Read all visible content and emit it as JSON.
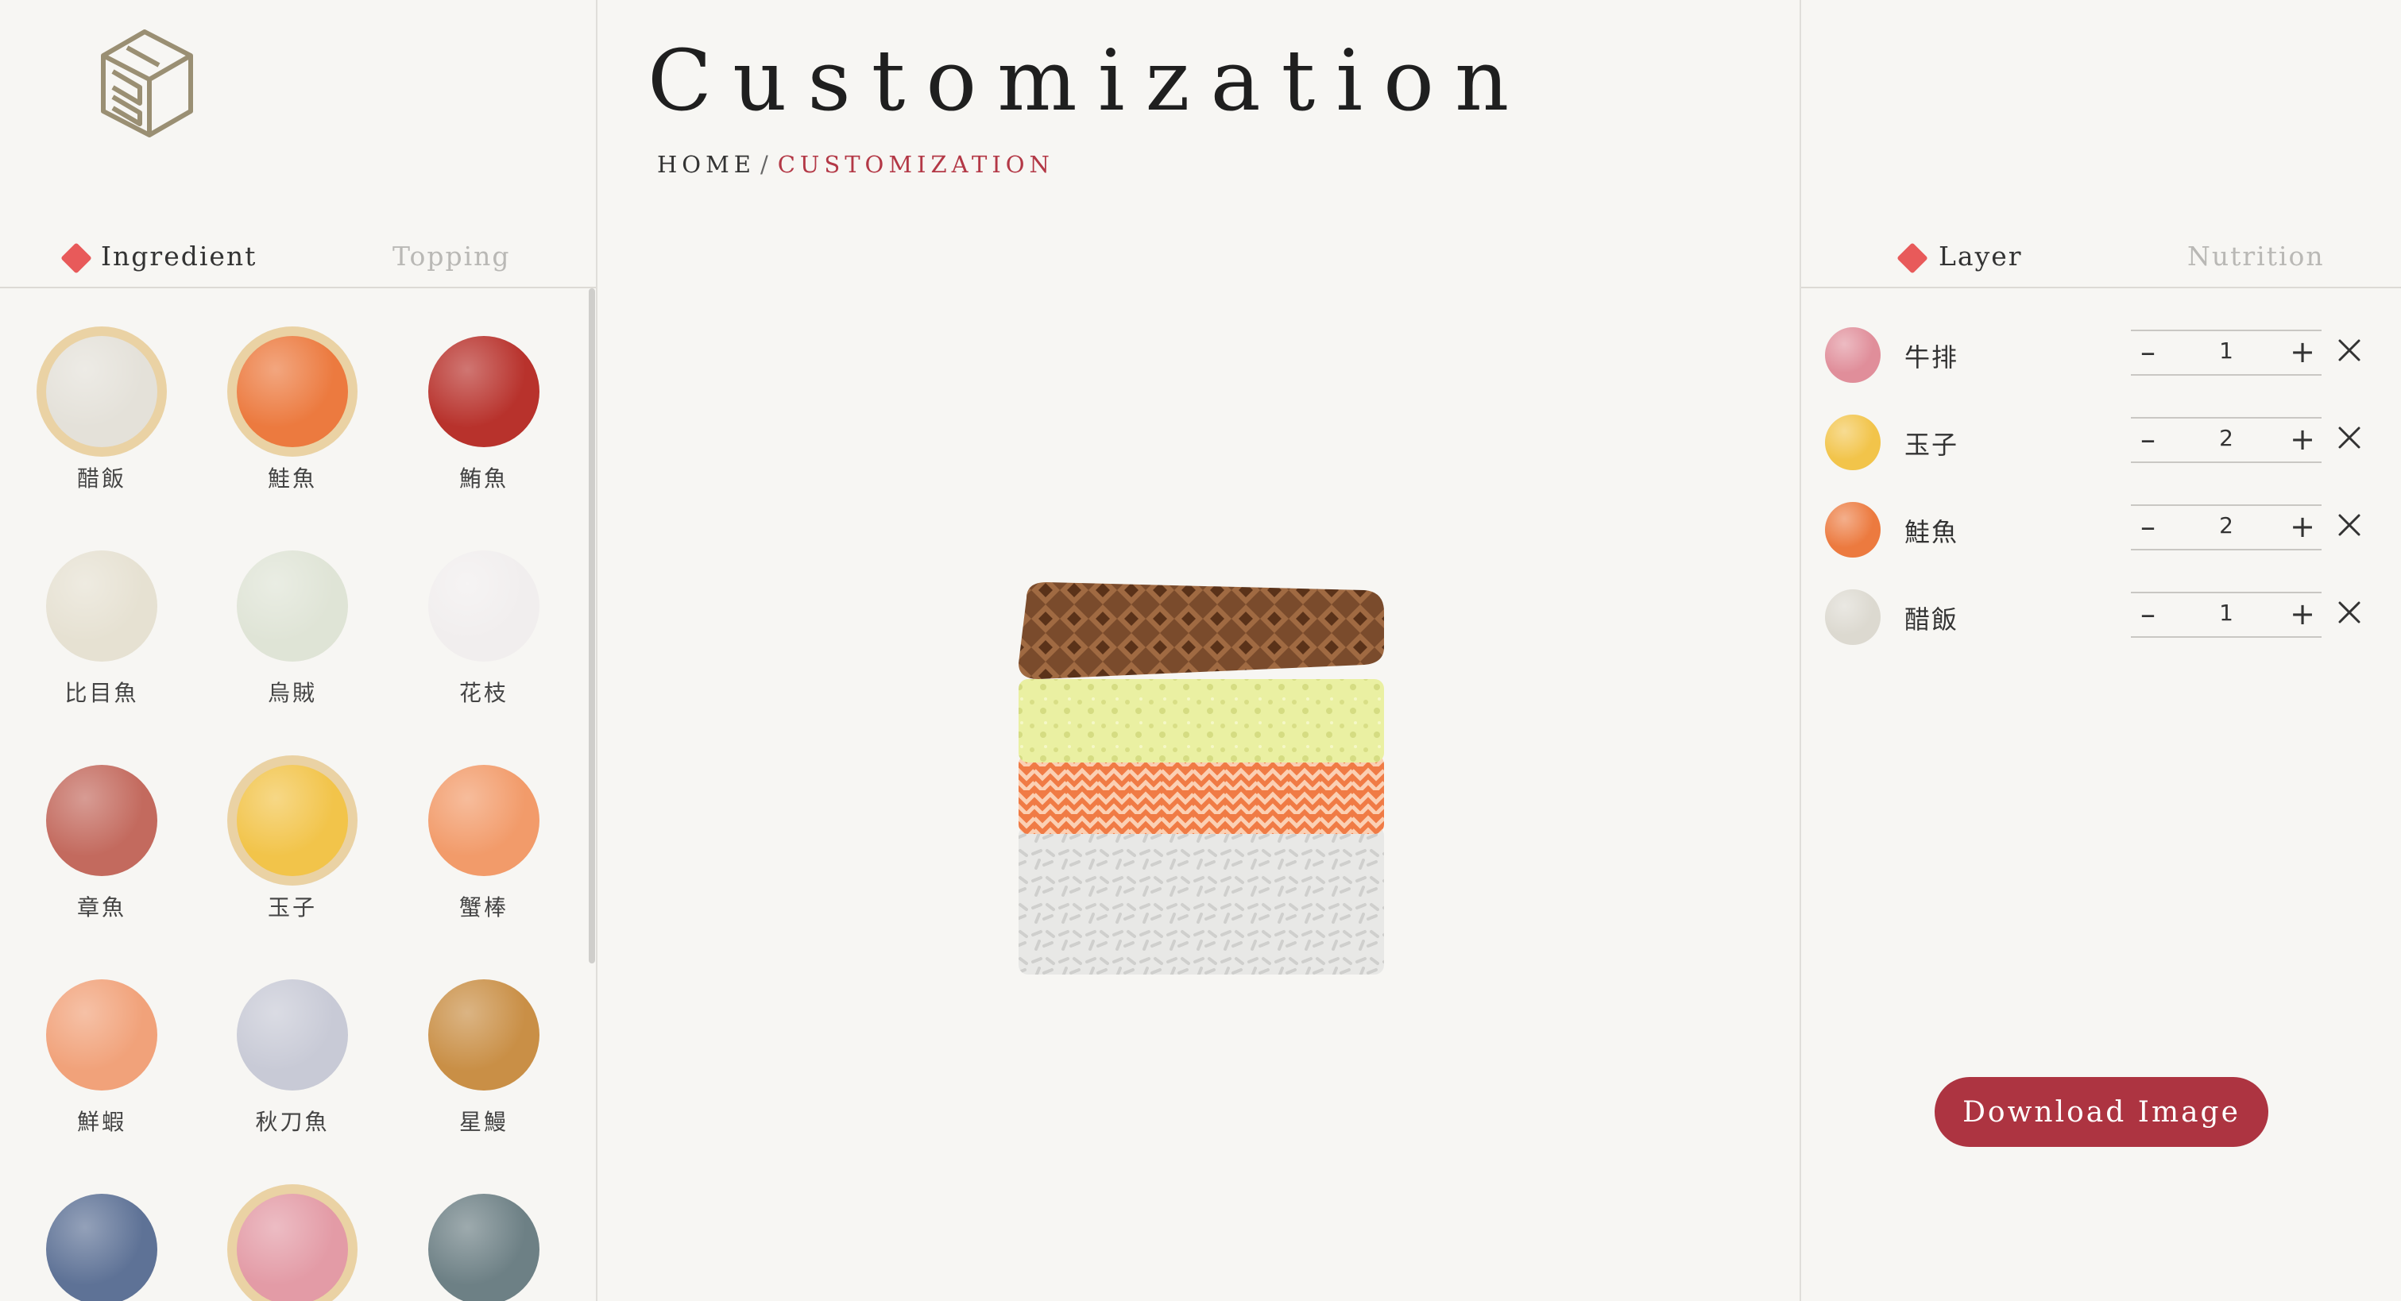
{
  "left_panel": {
    "tabs": [
      {
        "label": "Ingredient",
        "active": true
      },
      {
        "label": "Topping",
        "active": false
      }
    ],
    "ingredients": [
      {
        "name": "醋飯",
        "selected": true,
        "color": "#e4e1d9"
      },
      {
        "name": "鮭魚",
        "selected": true,
        "color": "#ec7a3f"
      },
      {
        "name": "鮪魚",
        "selected": false,
        "color": "#b8322c"
      },
      {
        "name": "比目魚",
        "selected": false,
        "color": "#e6e1d2"
      },
      {
        "name": "烏賊",
        "selected": false,
        "color": "#dfe4d6"
      },
      {
        "name": "花枝",
        "selected": false,
        "color": "#f1eeee"
      },
      {
        "name": "章魚",
        "selected": false,
        "color": "#c36a5e"
      },
      {
        "name": "玉子",
        "selected": true,
        "color": "#f2c44a"
      },
      {
        "name": "蟹棒",
        "selected": false,
        "color": "#f29b6a"
      },
      {
        "name": "鮮蝦",
        "selected": false,
        "color": "#f1a27a"
      },
      {
        "name": "秋刀魚",
        "selected": false,
        "color": "#c8cad6"
      },
      {
        "name": "星鰻",
        "selected": false,
        "color": "#c98f46"
      },
      {
        "name": "",
        "selected": false,
        "color": "#5e7296"
      },
      {
        "name": "",
        "selected": true,
        "color": "#e39ba6"
      },
      {
        "name": "",
        "selected": false,
        "color": "#6d8085"
      }
    ]
  },
  "main": {
    "title": "Customization",
    "breadcrumb": {
      "home": "HOME",
      "separator": "/",
      "current": "CUSTOMIZATION"
    }
  },
  "right_panel": {
    "tabs": [
      {
        "label": "Layer",
        "active": true
      },
      {
        "label": "Nutrition",
        "active": false
      }
    ],
    "layers": [
      {
        "name": "牛排",
        "qty": "1",
        "color": "#e08e9a"
      },
      {
        "name": "玉子",
        "qty": "2",
        "color": "#f2c44a"
      },
      {
        "name": "鮭魚",
        "qty": "2",
        "color": "#ec7a3f"
      },
      {
        "name": "醋飯",
        "qty": "1",
        "color": "#dcd9d0"
      }
    ],
    "stepper": {
      "minus": "–",
      "plus": "+"
    },
    "download_label": "Download Image"
  },
  "colors": {
    "accent": "#ad3441",
    "marker": "#e85a5a",
    "selected_ring": "#ead2a4",
    "background": "#f7f6f3"
  }
}
